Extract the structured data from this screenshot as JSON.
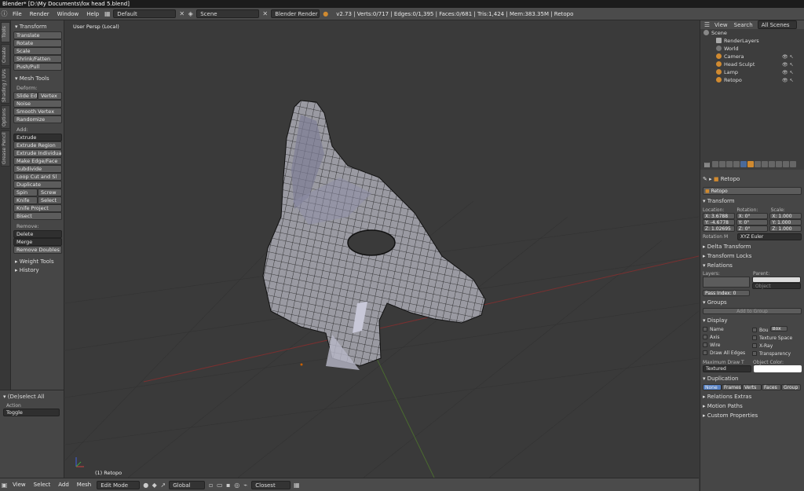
{
  "window": {
    "title": "Blender* [D:\\My Documents\\fox head 5.blend]"
  },
  "menubar": {
    "menus": [
      "File",
      "Render",
      "Window",
      "Help"
    ],
    "screen_layout": "Default",
    "scene": "Scene",
    "render_engine": "Blender Render",
    "stats": "v2.73 | Verts:0/717 | Edges:0/1,395 | Faces:0/681 | Tris:1,424 | Mem:383.35M | Retopo"
  },
  "vtabs": [
    "Tools",
    "Create",
    "Shading / UVs",
    "Options",
    "Grease Pencil"
  ],
  "tools": {
    "transform_header": "Transform",
    "transform_buttons": [
      "Translate",
      "Rotate",
      "Scale",
      "Shrink/Fatten",
      "Push/Pull"
    ],
    "mesh_tools_header": "Mesh Tools",
    "deform_label": "Deform:",
    "slide_edge": "Slide Ed",
    "vertex": "Vertex",
    "noise": "Noise",
    "smooth_vertex": "Smooth Vertex",
    "randomize": "Randomize",
    "add_label": "Add:",
    "extrude_dd": "Extrude",
    "add_buttons": [
      "Extrude Region",
      "Extrude Individual",
      "Make Edge/Face",
      "Subdivide",
      "Loop Cut and Sl",
      "Duplicate"
    ],
    "spin": "Spin",
    "screw": "Screw",
    "knife": "Knife",
    "select": "Select",
    "knife_project": "Knife Project",
    "bisect": "Bisect",
    "remove_label": "Remove:",
    "delete_dd": "Delete",
    "merge_dd": "Merge",
    "remove_doubles": "Remove Doubles",
    "weight_tools": "Weight Tools",
    "history": "History"
  },
  "operator": {
    "title": "(De)select All",
    "action_label": "Action",
    "action_value": "Toggle"
  },
  "viewport": {
    "info": "User Persp (Local)",
    "object_label": "(1) Retopo"
  },
  "bottombar": {
    "menus": [
      "View",
      "Select",
      "Add",
      "Mesh"
    ],
    "mode": "Edit Mode",
    "orientation": "Global",
    "snap": "Closest"
  },
  "outliner": {
    "menus": [
      "View",
      "Search"
    ],
    "filter": "All Scenes",
    "items": [
      "Scene",
      "RenderLayers",
      "World",
      "Camera",
      "Head Sculpt",
      "Lamp",
      "Retopo"
    ]
  },
  "properties": {
    "object_name_crumb": "Retopo",
    "object_name": "Retopo",
    "transform_header": "Transform",
    "location_label": "Location:",
    "rotation_label": "Rotation:",
    "scale_label": "Scale:",
    "loc": [
      "X: 3.6788",
      "Y: -4.6778",
      "Z: 1.02695"
    ],
    "rot": [
      "X: 0°",
      "Y: 0°",
      "Z: 0°"
    ],
    "scale": [
      "X: 1.000",
      "Y: 1.000",
      "Z: 1.000"
    ],
    "rotation_mode_label": "Rotation M",
    "rotation_mode": "XYZ Euler",
    "delta_transform": "Delta Transform",
    "transform_locks": "Transform Locks",
    "relations": "Relations",
    "layers_label": "Layers:",
    "parent_label": "Parent:",
    "pass_index": "Pass Index: 0",
    "object_dd": "Object",
    "groups": "Groups",
    "add_to_group": "Add to Group",
    "display": "Display",
    "display_opts": [
      "Name",
      "Axis",
      "Wire",
      "Draw All Edges"
    ],
    "display_opts_right": [
      "Bou",
      "Texture Space",
      "X-Ray",
      "Transparency"
    ],
    "bounds_dd": "Box",
    "max_draw_label": "Maximum Draw T",
    "object_color_label": "Object Color:",
    "max_draw_value": "Textured",
    "duplication": "Duplication",
    "dup_tabs": [
      "None",
      "Frames",
      "Verts",
      "Faces",
      "Group"
    ],
    "relations_extras": "Relations Extras",
    "motion_paths": "Motion Paths",
    "custom_properties": "Custom Properties"
  },
  "colors": {
    "accent": "#5680c2",
    "orange": "#d08a30",
    "mesh_face": "#9a9aa2",
    "wire": "#111111"
  }
}
